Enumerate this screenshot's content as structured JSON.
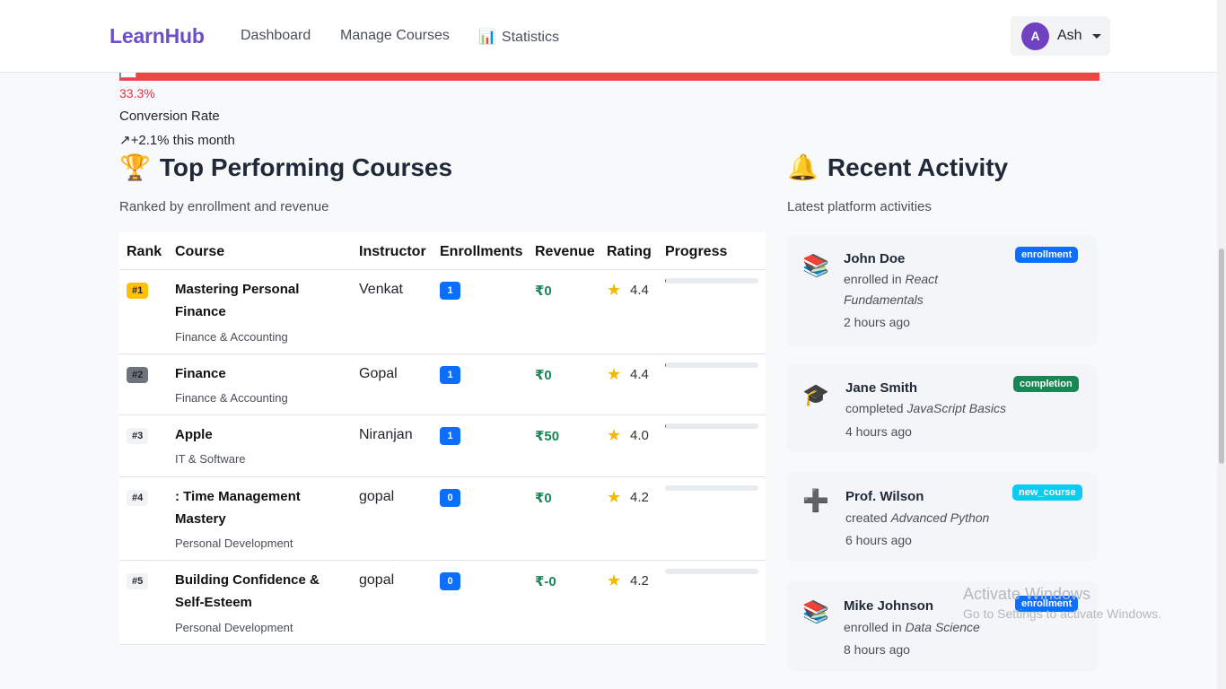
{
  "nav": {
    "brand": "LearnHub",
    "links": [
      {
        "label": "Dashboard"
      },
      {
        "label": "Manage Courses"
      },
      {
        "label": "Statistics",
        "emoji": "📊"
      }
    ],
    "user": {
      "initial": "A",
      "name": "Ash"
    }
  },
  "stat": {
    "percent": "33.3%",
    "label": "Conversion Rate",
    "trend": "↗+2.1% this month",
    "accent_color": "#ef4444"
  },
  "top_courses": {
    "emoji": "🏆",
    "title": "Top Performing Courses",
    "subtitle": "Ranked by enrollment and revenue",
    "columns": [
      "Rank",
      "Course",
      "Instructor",
      "Enrollments",
      "Revenue",
      "Rating",
      "Progress"
    ],
    "rows": [
      {
        "rank": "#1",
        "name": "Mastering Personal Finance",
        "category": "Finance & Accounting",
        "instructor": "Venkat",
        "enrollments": "1",
        "revenue": "₹0",
        "rating": "4.4",
        "progress": 1
      },
      {
        "rank": "#2",
        "name": "Finance",
        "category": "Finance & Accounting",
        "instructor": "Gopal",
        "enrollments": "1",
        "revenue": "₹0",
        "rating": "4.4",
        "progress": 1
      },
      {
        "rank": "#3",
        "name": "Apple",
        "category": "IT & Software",
        "instructor": "Niranjan",
        "enrollments": "1",
        "revenue": "₹50",
        "rating": "4.0",
        "progress": 1
      },
      {
        "rank": "#4",
        "name": ": Time Management Mastery",
        "category": "Personal Development",
        "instructor": "gopal",
        "enrollments": "0",
        "revenue": "₹0",
        "rating": "4.2",
        "progress": 0
      },
      {
        "rank": "#5",
        "name": "Building Confidence & Self-Esteem",
        "category": "Personal Development",
        "instructor": "gopal",
        "enrollments": "0",
        "revenue": "₹-0",
        "rating": "4.2",
        "progress": 0
      }
    ],
    "rank_colors": {
      "gold": "#ffc107",
      "silver": "#6c757d",
      "plain": "#f1f3f5"
    }
  },
  "recent_activity": {
    "emoji": "🔔",
    "title": "Recent Activity",
    "subtitle": "Latest platform activities",
    "items": [
      {
        "icon": "📚",
        "icon_name": "books-icon",
        "name": "John Doe",
        "action": "enrolled in",
        "target": "React Fundamentals",
        "time": "2 hours ago",
        "badge": "enrollment",
        "badge_color": "#0d6efd"
      },
      {
        "icon": "🎓",
        "icon_name": "graduation-cap-icon",
        "name": "Jane Smith",
        "action": "completed",
        "target": "JavaScript Basics",
        "time": "4 hours ago",
        "badge": "completion",
        "badge_color": "#198754"
      },
      {
        "icon": "➕",
        "icon_name": "plus-icon",
        "name": "Prof. Wilson",
        "action": "created",
        "target": "Advanced Python",
        "time": "6 hours ago",
        "badge": "new_course",
        "badge_color": "#0dcaf0"
      },
      {
        "icon": "📚",
        "icon_name": "books-icon",
        "name": "Mike Johnson",
        "action": "enrolled in",
        "target": "Data Science",
        "time": "8 hours ago",
        "badge": "enrollment",
        "badge_color": "#0d6efd"
      }
    ]
  },
  "watermark": {
    "line1": "Activate Windows",
    "line2": "Go to Settings to activate Windows."
  }
}
